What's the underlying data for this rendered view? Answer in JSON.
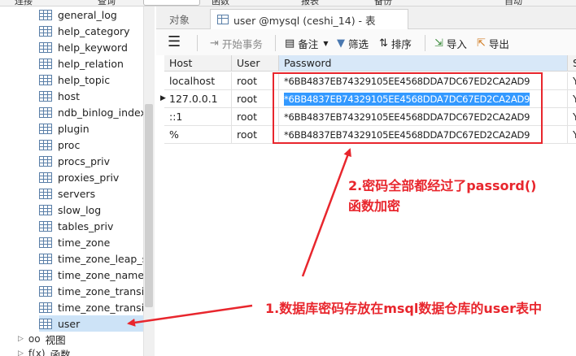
{
  "menubar": {
    "items": [
      "连接",
      "查询",
      "函数",
      "报表",
      "备份",
      "自动"
    ]
  },
  "tree": {
    "tables": [
      "general_log",
      "help_category",
      "help_keyword",
      "help_relation",
      "help_topic",
      "host",
      "ndb_binlog_index",
      "plugin",
      "proc",
      "procs_priv",
      "proxies_priv",
      "servers",
      "slow_log",
      "tables_priv",
      "time_zone",
      "time_zone_leap_se",
      "time_zone_name",
      "time_zone_transiti",
      "time_zone_transiti",
      "user"
    ],
    "selected_index": 19,
    "groups": [
      {
        "icon": "oo",
        "label": "视图"
      },
      {
        "icon": "f(x)",
        "label": "函数"
      }
    ]
  },
  "tabs": {
    "objects": "对象",
    "active": "user @mysql (ceshi_14) - 表"
  },
  "toolbar": {
    "begin_transaction": "开始事务",
    "memo": "备注",
    "filter": "筛选",
    "sort": "排序",
    "import": "导入",
    "export": "导出"
  },
  "grid": {
    "columns": [
      "Host",
      "User",
      "Password",
      "S"
    ],
    "rows": [
      {
        "host": "localhost",
        "user": "root",
        "password": "*6BB4837EB74329105EE4568DDA7DC67ED2CA2AD9",
        "s": "Y"
      },
      {
        "host": "127.0.0.1",
        "user": "root",
        "password": "*6BB4837EB74329105EE4568DDA7DC67ED2CA2AD9",
        "s": "Y"
      },
      {
        "host": "::1",
        "user": "root",
        "password": "*6BB4837EB74329105EE4568DDA7DC67ED2CA2AD9",
        "s": "Y"
      },
      {
        "host": "%",
        "user": "root",
        "password": "*6BB4837EB74329105EE4568DDA7DC67ED2CA2AD9",
        "s": "Y"
      }
    ],
    "current_row": 1
  },
  "annotations": {
    "note2_line1": "2.密码全部都经过了passord()",
    "note2_line2": "函数加密",
    "note1": "1.数据库密码存放在msql数据仓库的user表中",
    "color": "#e8262d"
  }
}
